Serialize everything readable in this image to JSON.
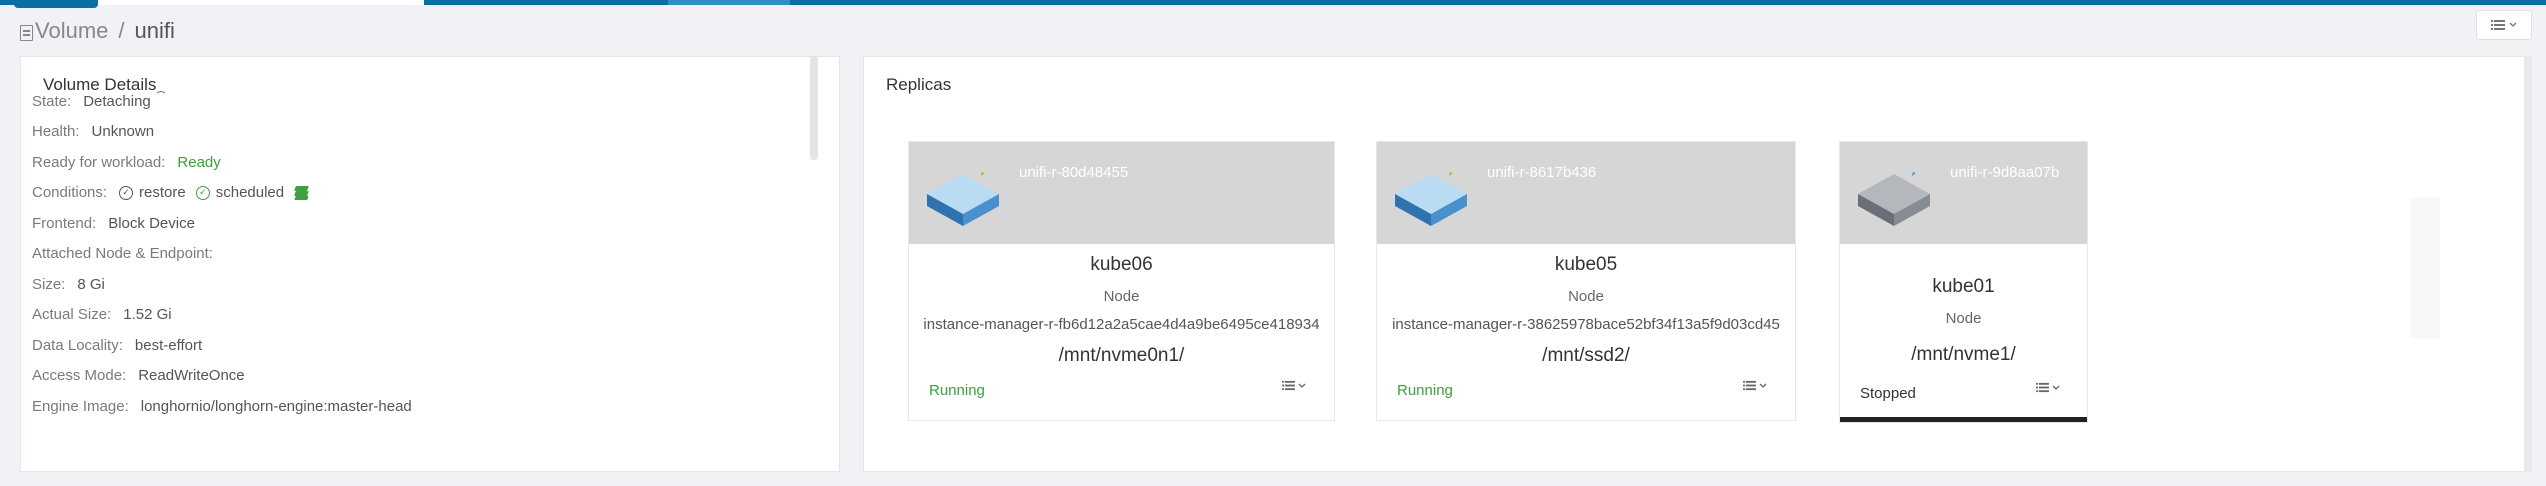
{
  "breadcrumb": {
    "parent": "Volume",
    "separator": "/",
    "current": "unifi"
  },
  "volume_details": {
    "title": "Volume Details",
    "state": {
      "label": "State:",
      "value": "Detaching"
    },
    "health": {
      "label": "Health:",
      "value": "Unknown"
    },
    "ready": {
      "label": "Ready for workload:",
      "value": "Ready"
    },
    "conditions": {
      "label": "Conditions:",
      "restore": "restore",
      "scheduled": "scheduled"
    },
    "frontend": {
      "label": "Frontend:",
      "value": "Block Device"
    },
    "attached": {
      "label": "Attached Node & Endpoint:"
    },
    "size": {
      "label": "Size:",
      "value": "8 Gi"
    },
    "actual_size": {
      "label": "Actual Size:",
      "value": "1.52 Gi"
    },
    "data_locality": {
      "label": "Data Locality:",
      "value": "best-effort"
    },
    "access_mode": {
      "label": "Access Mode:",
      "value": "ReadWriteOnce"
    },
    "engine_image": {
      "label": "Engine Image:",
      "value": "longhornio/longhorn-engine:master-head"
    }
  },
  "replicas": {
    "title": "Replicas",
    "items": [
      {
        "name": "unifi-r-80d48455",
        "node": "kube06",
        "node_label": "Node",
        "instance": "instance-manager-r-fb6d12a2a5cae4d4a9be6495ce418934",
        "path": "/mnt/nvme0n1/",
        "status": "Running"
      },
      {
        "name": "unifi-r-8617b436",
        "node": "kube05",
        "node_label": "Node",
        "instance": "instance-manager-r-38625978bace52bf34f13a5f9d03cd45",
        "path": "/mnt/ssd2/",
        "status": "Running"
      },
      {
        "name": "unifi-r-9d8aa07b",
        "node": "kube01",
        "node_label": "Node",
        "path": "/mnt/nvme1/",
        "status": "Stopped"
      }
    ]
  },
  "icons": {
    "menu": "list-menu-icon",
    "disk": "disk-icon",
    "check": "check-circle-icon",
    "layers": "layers-icon",
    "spinner": "spinner-icon",
    "document": "document-icon"
  },
  "colors": {
    "accent": "#0c6fa3",
    "running": "#3ca03c",
    "disk_active": "#5fa8dc",
    "disk_stopped": "#8a9098"
  }
}
